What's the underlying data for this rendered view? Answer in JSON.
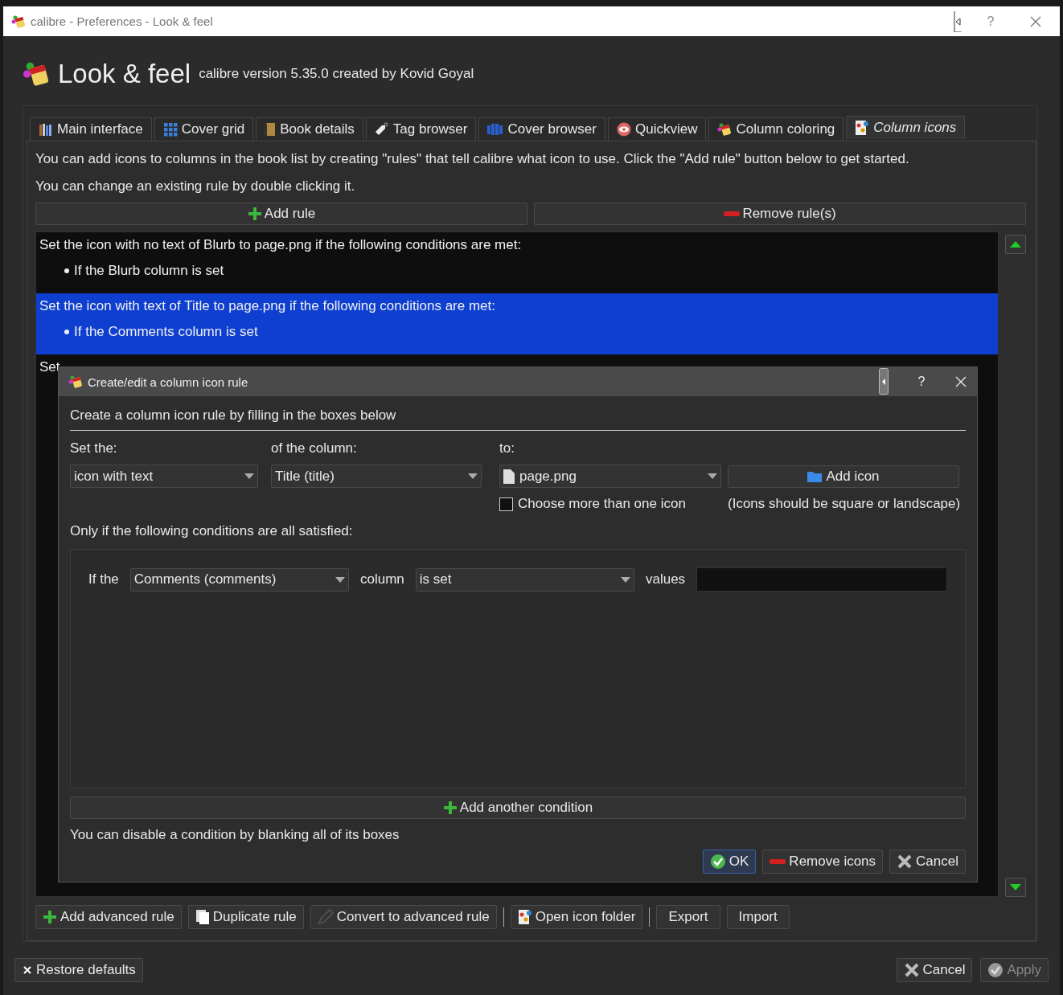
{
  "window": {
    "title": "calibre - Preferences - Look & feel",
    "help": "?"
  },
  "header": {
    "title": "Look & feel",
    "subtitle": "calibre version 5.35.0 created by Kovid Goyal"
  },
  "tabs": [
    {
      "label": "Main interface",
      "kind": "books",
      "selected": false
    },
    {
      "label": "Cover grid",
      "kind": "grid",
      "selected": false
    },
    {
      "label": "Book details",
      "kind": "book",
      "selected": false
    },
    {
      "label": "Tag browser",
      "kind": "tag",
      "selected": false
    },
    {
      "label": "Cover browser",
      "kind": "covers",
      "selected": false
    },
    {
      "label": "Quickview",
      "kind": "eye",
      "selected": false
    },
    {
      "label": "Column coloring",
      "kind": "paint",
      "selected": false
    },
    {
      "label": "Column icons",
      "kind": "icons",
      "selected": true
    }
  ],
  "intro": [
    "You can add icons to columns in the book list by creating \"rules\" that tell calibre what icon to use. Click the \"Add rule\" button below to get started.",
    "You can change an existing rule by double clicking it."
  ],
  "rule_buttons": [
    {
      "label": "Add rule",
      "kind": "add"
    },
    {
      "label": "Remove rule(s)",
      "kind": "remove"
    }
  ],
  "rules": [
    {
      "title": "Set the icon with no text of Blurb to page.png if the following conditions are met:",
      "conditions": [
        "If the Blurb column is set"
      ],
      "selected": false
    },
    {
      "title": "Set the icon with text of Title to page.png if the following conditions are met:",
      "conditions": [
        "If the Comments column is set"
      ],
      "selected": true
    },
    {
      "title": "Set",
      "selected": false
    }
  ],
  "bottom_buttons": [
    {
      "label": "Add advanced rule",
      "kind": "add"
    },
    {
      "label": "Duplicate rule",
      "kind": "copy"
    },
    {
      "label": "Convert to advanced rule",
      "kind": "pen"
    },
    {
      "label": "Open icon folder",
      "kind": "icons"
    },
    {
      "label": "Export",
      "kind": "plain"
    },
    {
      "label": "Import",
      "kind": "plain"
    }
  ],
  "footer": {
    "restore": "Restore defaults",
    "buttons": [
      {
        "label": "Cancel",
        "kind": "cancel",
        "disabled": false
      },
      {
        "label": "Apply",
        "kind": "apply",
        "disabled": true
      }
    ]
  },
  "dialog": {
    "title": "Create/edit a column icon rule",
    "help": "?",
    "heading": "Create a column icon rule by filling in the boxes below",
    "set_label": "Set the:",
    "column_label": "of the column:",
    "to_label": "to:",
    "set_value": "icon with text",
    "column_value": "Title (title)",
    "icon_value": "page.png",
    "add_icon": "Add icon",
    "multiple": {
      "label": "Choose more than one icon",
      "checked": false
    },
    "note": "(Icons should be square or landscape)",
    "conditions_label": "Only if the following conditions are all satisfied:",
    "conditions": [
      {
        "prefix": "If the",
        "column": "Comments (comments)",
        "middle": "column",
        "op": "is set",
        "values_label": "values"
      }
    ],
    "add_condition": "Add another condition",
    "hint": "You can disable a condition by blanking all of its boxes",
    "buttons": [
      {
        "label": "OK",
        "kind": "ok",
        "default": true
      },
      {
        "label": "Remove icons",
        "kind": "remove",
        "default": false
      },
      {
        "label": "Cancel",
        "kind": "cancel",
        "default": false
      }
    ]
  }
}
